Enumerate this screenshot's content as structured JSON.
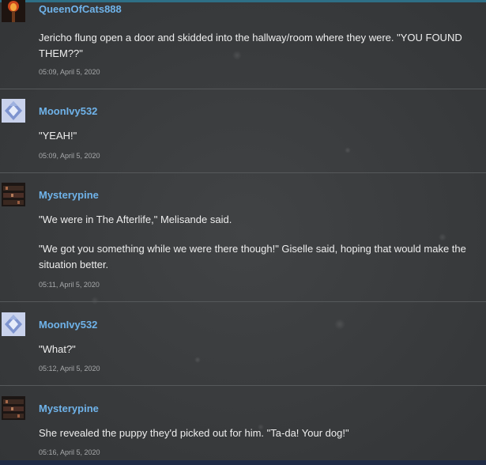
{
  "comments": [
    {
      "username": "QueenOfCats888",
      "avatar": "torch-avatar-icon",
      "paragraphs": [
        "Jericho flung open a door and skidded into the hallway/room where they were. \"YOU FOUND THEM??\""
      ],
      "timestamp": "05:09, April 5, 2020"
    },
    {
      "username": "MoonIvy532",
      "avatar": "crystal-avatar-icon",
      "paragraphs": [
        "\"YEAH!\""
      ],
      "timestamp": "05:09, April 5, 2020"
    },
    {
      "username": "Mysterypine",
      "avatar": "shelf-avatar-icon",
      "paragraphs": [
        "\"We were in The Afterlife,\" Melisande said.",
        "\"We got you something while we were there though!\" Giselle said, hoping that would make the situation better."
      ],
      "timestamp": "05:11, April 5, 2020"
    },
    {
      "username": "MoonIvy532",
      "avatar": "crystal-avatar-icon",
      "paragraphs": [
        "\"What?\""
      ],
      "timestamp": "05:12, April 5, 2020"
    },
    {
      "username": "Mysterypine",
      "avatar": "shelf-avatar-icon",
      "paragraphs": [
        "She revealed the puppy they'd picked out for him. \"Ta-da! Your dog!\""
      ],
      "timestamp": "05:16, April 5, 2020"
    }
  ],
  "colors": {
    "username": "#6fb3ea",
    "text": "#eeeeee",
    "timestamp": "#a7a9ab",
    "background": "#3a3c3e",
    "divider": "#56595b"
  }
}
